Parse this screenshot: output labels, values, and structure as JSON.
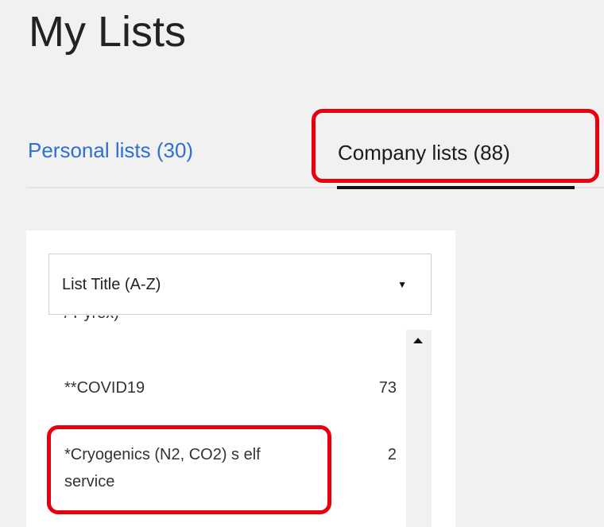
{
  "page": {
    "title": "My Lists"
  },
  "tabs": [
    {
      "label": "Personal lists (30)",
      "active": false
    },
    {
      "label": "Company lists (88)",
      "active": true
    }
  ],
  "sort": {
    "selected": "List Title (A-Z)"
  },
  "lists": [
    {
      "title": "/ Pyrex)",
      "count": ""
    },
    {
      "title": "**COVID19",
      "count": "73"
    },
    {
      "title": "*Cryogenics (N2, CO2) s elf service",
      "count": "2"
    }
  ],
  "colors": {
    "accent_link": "#2f6fd1",
    "highlight": "#e8000f",
    "active_tab_underline": "#111111"
  },
  "icons": {
    "sort_caret": "caret-down-icon",
    "scroll_up": "scroll-up-arrow-icon"
  }
}
